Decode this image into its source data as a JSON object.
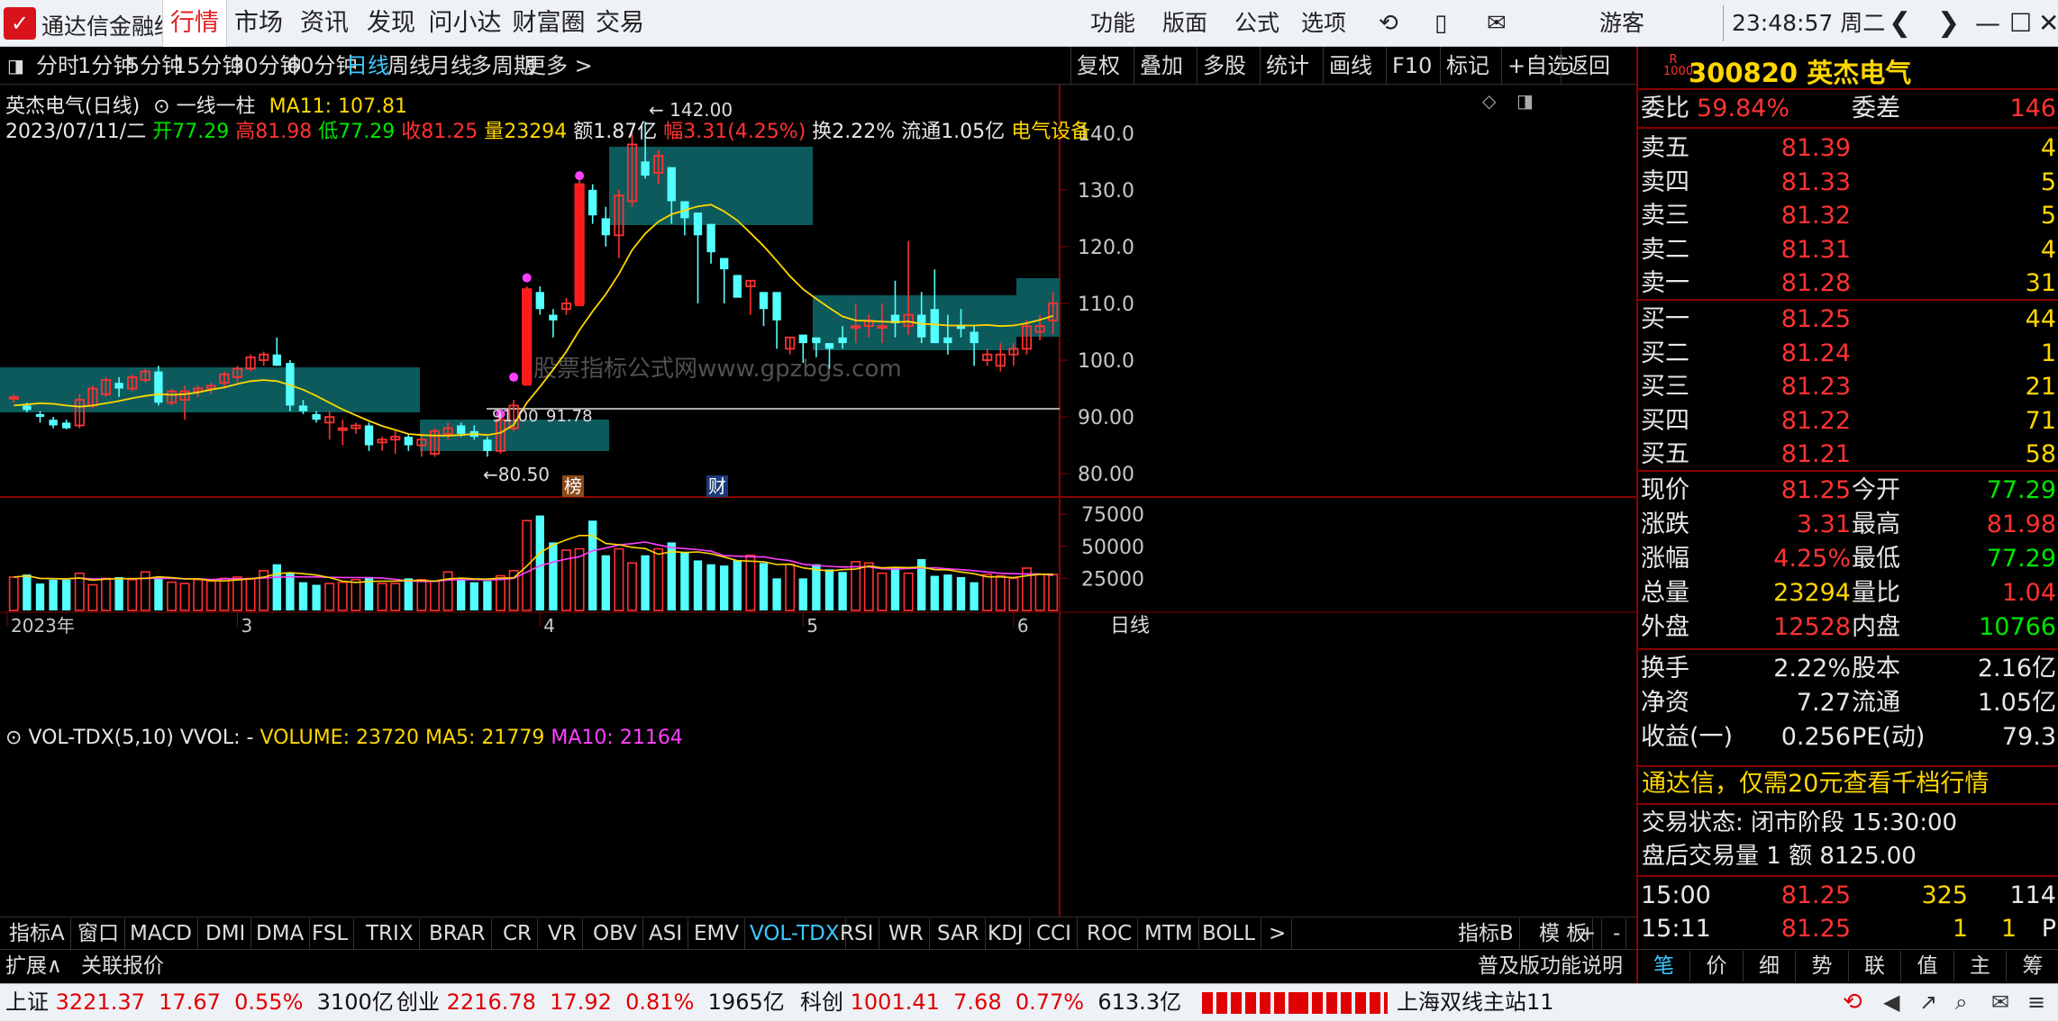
{
  "app": {
    "name": "通达信金融终端"
  },
  "top_nav": [
    "行情",
    "市场",
    "资讯",
    "发现",
    "问小达",
    "财富圈",
    "交易"
  ],
  "top_nav_active": 0,
  "top_right": {
    "menus": [
      "功能",
      "版面",
      "公式",
      "选项"
    ],
    "user": "游客",
    "time": "23:48:57 周二"
  },
  "toolbar": {
    "periods": [
      "分时",
      "1分钟",
      "5分钟",
      "15分钟",
      "30分钟",
      "60分钟",
      "日线",
      "周线",
      "月线",
      "多周期",
      "更多 >"
    ],
    "selected": 6,
    "right": [
      "复权",
      "叠加",
      "多股",
      "统计",
      "画线",
      "F10",
      "标记",
      "+自选",
      "返回"
    ]
  },
  "chart_header": {
    "name": "英杰电气(日线)",
    "indicator": "一线一柱",
    "ma_label": "MA11: 107.81",
    "date": "2023/07/11/二",
    "open_label": "开",
    "open": "77.29",
    "high_label": "高",
    "high": "81.98",
    "low_label": "低",
    "low": "77.29",
    "close_label": "收",
    "close": "81.25",
    "vol_label": "量",
    "vol": "23294",
    "amount": "额1.87亿",
    "chg_label": "幅",
    "chg": "3.31(4.25%)",
    "turnover": "换2.22%",
    "float_cap": "流通1.05亿",
    "sector": "电气设备"
  },
  "watermark": "股票指标公式网www.gpzbgs.com",
  "annotations": {
    "max": "142.00",
    "min": "80.50",
    "mid_left": "91.00",
    "mid_right": "91.78",
    "tag1": "榜",
    "tag2": "财"
  },
  "price_axis": [
    "140.0",
    "130.0",
    "120.0",
    "110.0",
    "100.0",
    "90.00",
    "80.00"
  ],
  "volume_header": {
    "name": "VOL-TDX(5,10)",
    "vvol": "VVOL: -",
    "volume": "VOLUME: 23720",
    "ma5": "MA5: 21779",
    "ma10": "MA10: 21164"
  },
  "volume_axis": [
    "75000",
    "50000",
    "25000"
  ],
  "time_axis": [
    "2023年",
    "3",
    "4",
    "5",
    "6"
  ],
  "timeframe_label": "日线",
  "indicator_tabs": [
    "指标A",
    "窗口",
    "MACD",
    "DMI",
    "DMA",
    "FSL",
    "TRIX",
    "BRAR",
    "CR",
    "VR",
    "OBV",
    "ASI",
    "EMV",
    "VOL-TDX",
    "RSI",
    "WR",
    "SAR",
    "KDJ",
    "CCI",
    "ROC",
    "MTM",
    "BOLL",
    ">"
  ],
  "indicator_selected": 13,
  "indicator_right": [
    "指标B",
    "模 板",
    "+",
    "-"
  ],
  "sub_bar": {
    "left": [
      "扩展∧",
      "关联报价"
    ],
    "right": "普及版功能说明"
  },
  "stock": {
    "code": "300820",
    "name": "英杰电气",
    "badge_top": "R",
    "badge_bot": "1000"
  },
  "order_ratio": {
    "label": "委比",
    "value": "59.84%",
    "diff_label": "委差",
    "diff": "146"
  },
  "asks": [
    {
      "label": "卖五",
      "price": "81.39",
      "vol": "4"
    },
    {
      "label": "卖四",
      "price": "81.33",
      "vol": "5"
    },
    {
      "label": "卖三",
      "price": "81.32",
      "vol": "5"
    },
    {
      "label": "卖二",
      "price": "81.31",
      "vol": "4"
    },
    {
      "label": "卖一",
      "price": "81.28",
      "vol": "31"
    }
  ],
  "bids": [
    {
      "label": "买一",
      "price": "81.25",
      "vol": "44"
    },
    {
      "label": "买二",
      "price": "81.24",
      "vol": "1"
    },
    {
      "label": "买三",
      "price": "81.23",
      "vol": "21"
    },
    {
      "label": "买四",
      "price": "81.22",
      "vol": "71"
    },
    {
      "label": "买五",
      "price": "81.21",
      "vol": "58"
    }
  ],
  "quote": [
    {
      "l1": "现价",
      "v1": "81.25",
      "c1": "red",
      "l2": "今开",
      "v2": "77.29",
      "c2": "grn"
    },
    {
      "l1": "涨跌",
      "v1": "3.31",
      "c1": "red",
      "l2": "最高",
      "v2": "81.98",
      "c2": "red"
    },
    {
      "l1": "涨幅",
      "v1": "4.25%",
      "c1": "red",
      "l2": "最低",
      "v2": "77.29",
      "c2": "grn"
    },
    {
      "l1": "总量",
      "v1": "23294",
      "c1": "yel",
      "l2": "量比",
      "v2": "1.04",
      "c2": "red"
    },
    {
      "l1": "外盘",
      "v1": "12528",
      "c1": "red",
      "l2": "内盘",
      "v2": "10766",
      "c2": "grn"
    }
  ],
  "quote2": [
    {
      "l1": "换手",
      "v1": "2.22%",
      "l2": "股本",
      "v2": "2.16亿"
    },
    {
      "l1": "净资",
      "v1": "7.27",
      "l2": "流通",
      "v2": "1.05亿"
    },
    {
      "l1": "收益(一)",
      "v1": "0.256",
      "l2": "PE(动)",
      "v2": "79.3"
    }
  ],
  "promo": "通达信，仅需20元查看千档行情",
  "trade_state": "交易状态: 闭市阶段 15:30:00",
  "after_hours": "盘后交易量 1 额 8125.00",
  "ticks": [
    {
      "time": "15:00",
      "price": "81.25",
      "vol": "325",
      "num": "114"
    },
    {
      "time": "15:11",
      "price": "81.25",
      "vol": "1",
      "num": "P",
      "extra": "1"
    }
  ],
  "right_tabs": [
    "笔",
    "价",
    "细",
    "势",
    "联",
    "值",
    "主",
    "筹"
  ],
  "status": {
    "sh_label": "上证",
    "sh": "3221.37",
    "sh_chg": "17.67",
    "sh_pct": "0.55%",
    "sh_amt": "3100亿",
    "cy_label": "创业",
    "cy": "2216.78",
    "cy_chg": "17.92",
    "cy_pct": "0.81%",
    "cy_amt": "1965亿",
    "kc_label": "科创",
    "kc": "1001.41",
    "kc_chg": "7.68",
    "kc_pct": "0.77%",
    "kc_amt": "613.3亿",
    "server": "上海双线主站11"
  },
  "chart_data": {
    "type": "candlestick",
    "price_range": [
      77,
      146
    ],
    "volume_range": [
      0,
      80000
    ],
    "candles": [
      [
        93.5,
        94,
        92.5,
        93.5
      ],
      [
        92,
        92.5,
        90.8,
        91.2
      ],
      [
        90.5,
        91,
        89,
        90
      ],
      [
        89.5,
        90,
        88,
        88.5
      ],
      [
        89,
        89.5,
        87.8,
        88
      ],
      [
        88.5,
        94,
        88,
        93
      ],
      [
        92,
        95.5,
        91.5,
        95
      ],
      [
        94,
        97,
        93.5,
        96.5
      ],
      [
        96,
        97,
        93.5,
        95
      ],
      [
        95,
        97.5,
        94.5,
        97
      ],
      [
        96.5,
        98.5,
        96,
        98
      ],
      [
        98,
        99,
        92,
        92.5
      ],
      [
        92.5,
        95,
        92,
        94.5
      ],
      [
        93,
        95.5,
        89.5,
        94.5
      ],
      [
        94.5,
        95.5,
        93.5,
        95
      ],
      [
        95,
        96,
        94,
        95.5
      ],
      [
        96,
        98,
        95,
        97.5
      ],
      [
        97,
        99,
        96,
        98.5
      ],
      [
        98.5,
        101,
        98,
        100.5
      ],
      [
        100,
        101.5,
        99,
        101
      ],
      [
        101,
        104,
        100,
        99
      ],
      [
        99.5,
        100,
        91,
        92
      ],
      [
        92,
        93,
        90.5,
        91
      ],
      [
        90.5,
        91,
        89,
        89.5
      ],
      [
        89,
        91,
        86,
        90
      ],
      [
        88,
        89.5,
        85,
        88
      ],
      [
        88,
        89,
        87,
        88.5
      ],
      [
        88.5,
        89,
        84,
        85
      ],
      [
        85.5,
        86.5,
        84,
        86
      ],
      [
        86,
        87.5,
        83.5,
        86.5
      ],
      [
        86.5,
        87,
        84,
        85
      ],
      [
        85,
        87,
        83,
        86
      ],
      [
        83.5,
        88,
        83,
        87.5
      ],
      [
        87,
        89,
        86,
        88
      ],
      [
        88.5,
        89,
        86.5,
        87
      ],
      [
        87.5,
        88.5,
        86,
        86.5
      ],
      [
        86,
        86.5,
        83,
        84
      ],
      [
        84,
        90,
        83.5,
        89.5
      ],
      [
        88,
        93,
        87.5,
        92
      ],
      [
        96,
        113,
        95.5,
        112.5
      ],
      [
        112,
        113,
        108,
        109
      ],
      [
        108,
        109,
        104,
        107
      ],
      [
        109,
        111,
        108,
        110
      ],
      [
        110,
        132,
        109.5,
        131
      ],
      [
        130,
        131,
        124,
        125.5
      ],
      [
        125,
        127,
        120,
        122
      ],
      [
        122,
        130,
        118,
        129
      ],
      [
        128,
        140,
        127,
        138
      ],
      [
        135,
        142,
        132,
        132.5
      ],
      [
        133,
        137,
        131,
        136
      ],
      [
        134,
        131,
        124,
        128
      ],
      [
        128,
        125,
        122,
        125
      ],
      [
        126,
        118,
        110,
        122
      ],
      [
        124,
        122,
        117,
        119
      ],
      [
        118,
        118,
        110,
        116
      ],
      [
        115,
        114,
        111,
        111
      ],
      [
        113,
        112,
        108,
        114
      ],
      [
        112,
        111,
        106,
        109
      ],
      [
        112,
        106,
        102,
        107
      ],
      [
        102,
        103,
        101,
        104
      ],
      [
        104.5,
        100,
        99.5,
        103
      ],
      [
        104,
        101,
        100.5,
        103
      ],
      [
        103,
        99,
        98.5,
        102
      ],
      [
        104,
        106,
        102,
        103
      ],
      [
        106,
        110,
        103,
        106
      ],
      [
        106,
        108,
        104,
        107
      ],
      [
        106,
        110,
        103,
        106
      ],
      [
        108,
        114,
        104,
        106.5
      ],
      [
        106,
        121,
        104.5,
        108
      ],
      [
        108,
        112,
        103,
        104
      ],
      [
        109,
        116,
        103,
        103
      ],
      [
        104,
        108,
        101,
        103
      ],
      [
        106,
        109,
        104,
        105.5
      ],
      [
        105,
        106,
        99,
        103
      ],
      [
        100,
        102,
        99,
        101
      ],
      [
        99,
        103,
        98,
        101
      ],
      [
        101,
        103,
        99,
        102
      ],
      [
        102,
        107,
        101,
        106
      ],
      [
        105,
        108,
        103.5,
        106
      ],
      [
        107,
        112,
        104.5,
        110
      ]
    ],
    "ma_line": [
      92,
      92.2,
      92.4,
      92.3,
      92,
      91.8,
      92,
      92.4,
      92.8,
      93.3,
      93.7,
      94,
      93.9,
      94,
      94.3,
      94.8,
      95.2,
      95.8,
      96.3,
      96.5,
      96.3,
      95.6,
      94.8,
      93.7,
      92.5,
      91.3,
      90.3,
      89.3,
      88.4,
      87.7,
      87,
      86.8,
      86.7,
      86.7,
      86.8,
      87,
      86.8,
      87.2,
      88.6,
      92.5,
      95.3,
      98.3,
      101.5,
      105.3,
      108.6,
      111.6,
      115.2,
      119.4,
      122.3,
      124.4,
      125.7,
      126.4,
      127.1,
      127.4,
      126.2,
      124.6,
      122.4,
      120.1,
      117.5,
      114.8,
      112.5,
      110.8,
      109.2,
      107.7,
      107,
      106.9,
      106.8,
      106.7,
      106.8,
      106.4,
      106.3,
      106.1,
      106.1,
      106.1,
      106.2,
      106,
      106.1,
      106.5,
      107.1,
      107.8
    ],
    "volumes": [
      26000,
      28000,
      21000,
      24000,
      24000,
      29000,
      20000,
      25000,
      26000,
      24000,
      30000,
      26000,
      22000,
      21000,
      24000,
      23000,
      25000,
      26000,
      25000,
      31000,
      36000,
      29000,
      22000,
      20000,
      21000,
      22000,
      24000,
      26000,
      21000,
      21000,
      25000,
      24000,
      23000,
      30000,
      24000,
      22000,
      23000,
      27000,
      31000,
      70000,
      74000,
      53000,
      47000,
      48000,
      70000,
      43000,
      48000,
      37000,
      43000,
      48000,
      53000,
      45000,
      39000,
      36000,
      35000,
      39000,
      43000,
      37000,
      25000,
      36000,
      25000,
      36000,
      32000,
      30000,
      38000,
      37000,
      29000,
      34000,
      29000,
      40000,
      27000,
      28000,
      26000,
      22000,
      28000,
      27000,
      25000,
      33000,
      28000,
      28000
    ]
  }
}
